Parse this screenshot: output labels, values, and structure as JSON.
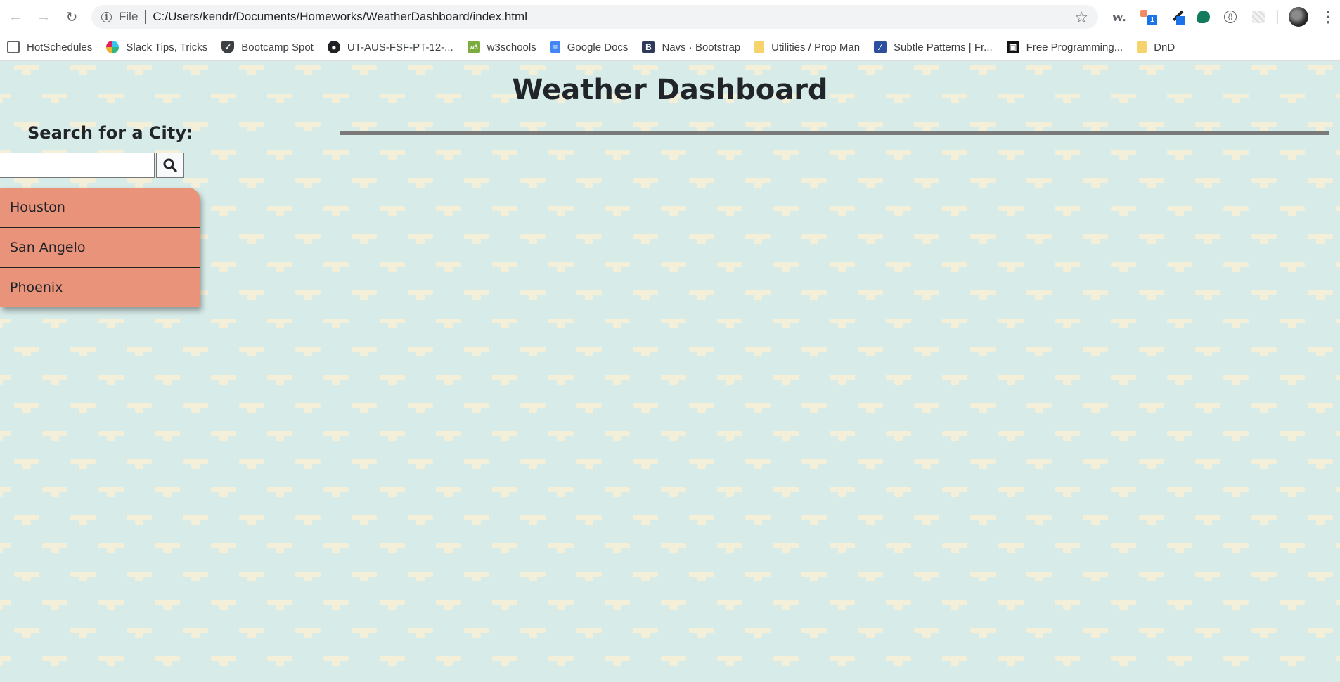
{
  "browser": {
    "url_scheme": "File",
    "url": "C:/Users/kendr/Documents/Homeworks/WeatherDashboard/index.html",
    "extensions": [
      "w.",
      "1"
    ],
    "bookmarks": [
      {
        "label": "HotSchedules",
        "icon": "hotschedules-icon",
        "color": "#5f6368"
      },
      {
        "label": "Slack Tips, Tricks",
        "icon": "slack-icon",
        "color": "#e01e5a"
      },
      {
        "label": "Bootcamp Spot",
        "icon": "bootcamp-shield-icon",
        "color": "#3c4043"
      },
      {
        "label": "UT-AUS-FSF-PT-12-...",
        "icon": "github-icon",
        "color": "#202124"
      },
      {
        "label": "w3schools",
        "icon": "w3schools-icon",
        "color": "#7cab3f"
      },
      {
        "label": "Google Docs",
        "icon": "google-docs-icon",
        "color": "#4285f4"
      },
      {
        "label": "Navs · Bootstrap",
        "icon": "bootstrap-icon",
        "color": "#2f3a5a"
      },
      {
        "label": "Utilities / Prop Man",
        "icon": "folder-icon",
        "color": "#f6d36b"
      },
      {
        "label": "Subtle Patterns | Fr...",
        "icon": "subtle-patterns-icon",
        "color": "#2d4f9f"
      },
      {
        "label": "Free Programming...",
        "icon": "free-programming-icon",
        "color": "#111111"
      },
      {
        "label": "DnD",
        "icon": "folder-icon",
        "color": "#f6d36b"
      }
    ]
  },
  "page": {
    "title": "Weather Dashboard",
    "search_label": "Search for a City:",
    "search_value": "",
    "search_button_icon": "search-icon",
    "cities": [
      "Houston",
      "San Angelo",
      "Phoenix"
    ],
    "colors": {
      "background": "#d7ebe9",
      "pattern": "#f3efd9",
      "city_list": "#e9937a",
      "divider": "#7a7a7a"
    }
  }
}
